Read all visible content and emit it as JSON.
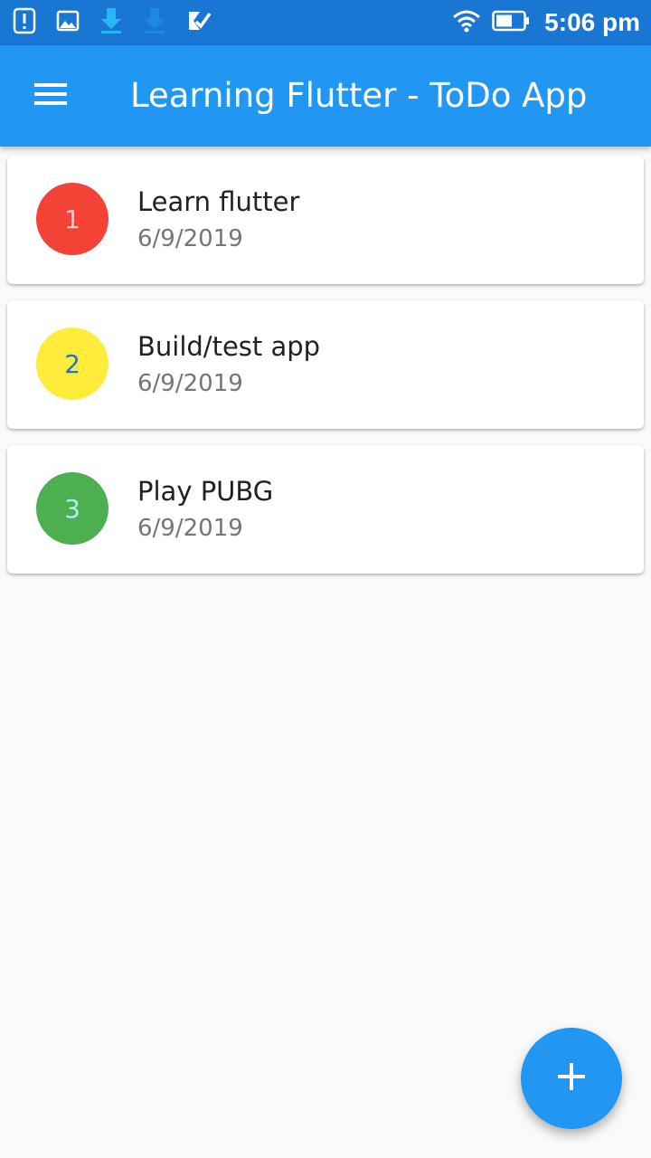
{
  "status_bar": {
    "time": "5:06 pm",
    "left_icons": [
      "alert-card-icon",
      "image-icon",
      "download-icon",
      "download-icon",
      "checklist-icon"
    ],
    "right_icons": [
      "wifi-icon",
      "battery-icon"
    ],
    "color": "#1976d2"
  },
  "app_bar": {
    "title": "Learning Flutter - ToDo App",
    "menu_icon": "menu-icon",
    "color": "#2196f3"
  },
  "todos": [
    {
      "number": "1",
      "title": "Learn flutter",
      "date": "6/9/2019",
      "avatar_color": "#f44336",
      "number_color": "#ffcdd2"
    },
    {
      "number": "2",
      "title": "Build/test app",
      "date": "6/9/2019",
      "avatar_color": "#ffeb3b",
      "number_color": "#1976d2"
    },
    {
      "number": "3",
      "title": "Play PUBG",
      "date": "6/9/2019",
      "avatar_color": "#4caf50",
      "number_color": "#b2ebf2"
    }
  ],
  "fab": {
    "icon": "add-icon",
    "label": "+",
    "color": "#2196f3"
  }
}
